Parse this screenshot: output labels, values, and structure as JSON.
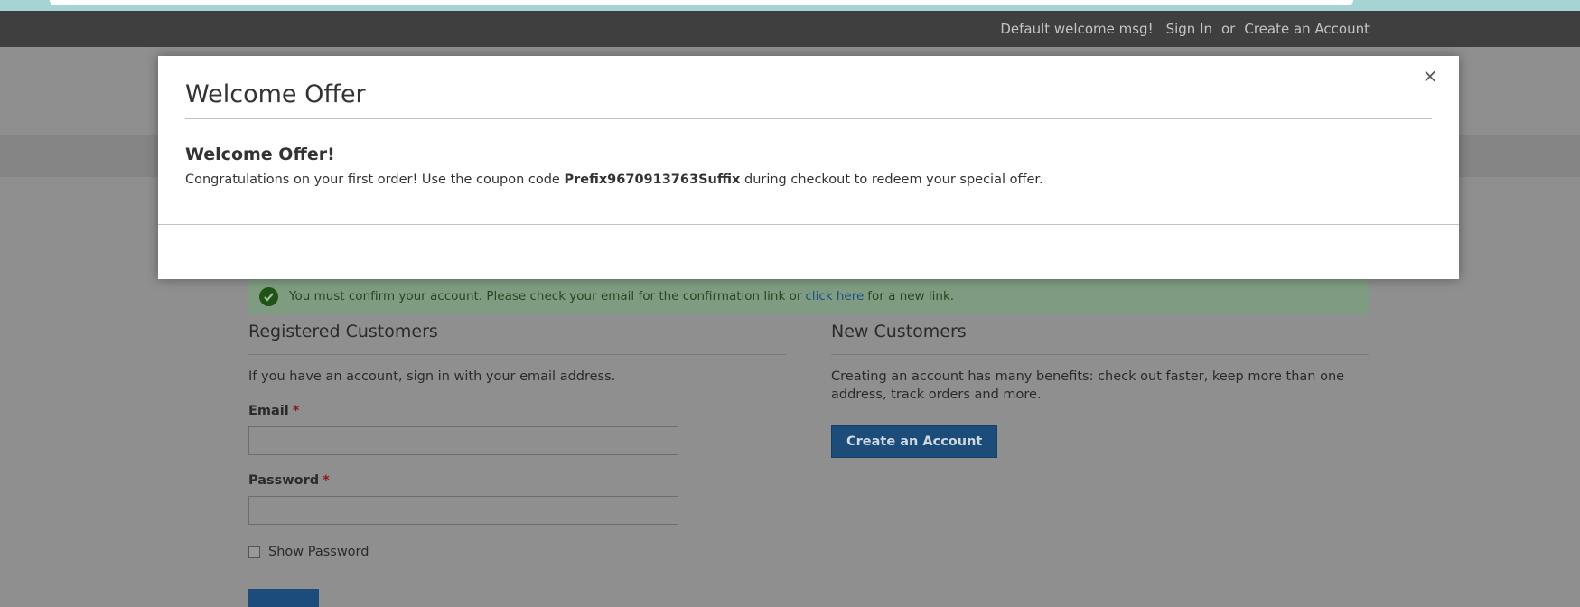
{
  "header": {
    "welcome": "Default welcome msg!",
    "sign_in": "Sign In",
    "or": "or",
    "create_account": "Create an Account"
  },
  "message": {
    "text_before": "You must confirm your account. Please check your email for the confirmation link or",
    "link": "click here",
    "text_after": "for a new link."
  },
  "registered": {
    "title": "Registered Customers",
    "note": "If you have an account, sign in with your email address.",
    "email_label": "Email",
    "password_label": "Password",
    "required_mark": "*",
    "show_password": "Show Password"
  },
  "new_customers": {
    "title": "New Customers",
    "note": "Creating an account has many benefits: check out faster, keep more than one address, track orders and more.",
    "button": "Create an Account"
  },
  "modal": {
    "title": "Welcome Offer",
    "close_glyph": "×",
    "offer_title": "Welcome Offer!",
    "offer_text_before": "Congratulations on your first order! Use the coupon code",
    "coupon_code": "Prefix9670913763Suffix",
    "offer_text_after": "during checkout to redeem your special offer."
  },
  "colors": {
    "success_accent": "#1f5317",
    "primary_button": "#1c4d7a"
  }
}
